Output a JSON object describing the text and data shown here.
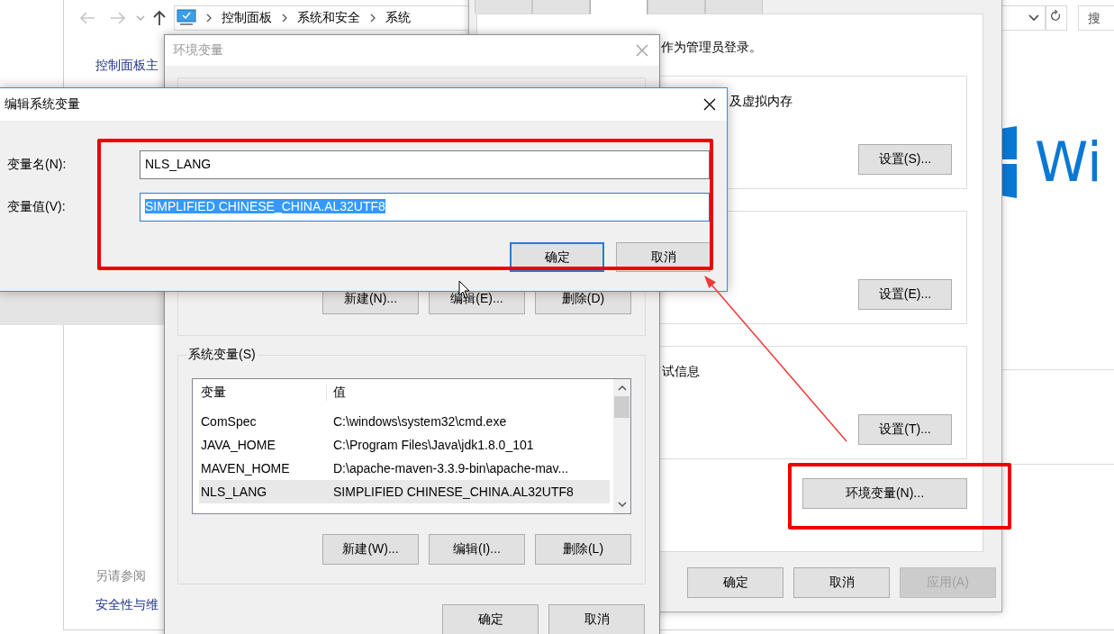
{
  "explorer": {
    "back_disabled": true,
    "forward_disabled": true,
    "breadcrumb": [
      "控制面板",
      "系统和安全",
      "系统"
    ],
    "search_placeholder": "搜",
    "sidebar_title": "控制面板主",
    "see_also": "另请参阅",
    "see_also_link": "安全性与维",
    "logo_text": "Wi"
  },
  "system_properties": {
    "tabs": [
      {
        "selected": false
      },
      {
        "selected": false
      },
      {
        "selected": true
      },
      {
        "selected": false
      },
      {
        "selected": false
      }
    ],
    "admin_note": "作为管理员登录。",
    "groups": [
      {
        "note": "及虚拟内存",
        "button": "设置(S)..."
      },
      {
        "button": "设置(E)..."
      },
      {
        "note": "试信息",
        "button": "设置(T)..."
      }
    ],
    "env_button": "环境变量(N)...",
    "buttons": [
      {
        "label": "确定",
        "disabled": false
      },
      {
        "label": "取消",
        "disabled": false
      },
      {
        "label": "应用(A)",
        "disabled": true
      }
    ]
  },
  "env_window": {
    "title": "环境变量",
    "active": false,
    "user_buttons": [
      "新建(N)...",
      "编辑(E)...",
      "删除(D)"
    ],
    "system_group": "系统变量(S)",
    "columns": [
      "变量",
      "值"
    ],
    "rows": [
      {
        "name": "ComSpec",
        "value": "C:\\windows\\system32\\cmd.exe",
        "selected": false
      },
      {
        "name": "JAVA_HOME",
        "value": "C:\\Program Files\\Java\\jdk1.8.0_101",
        "selected": false
      },
      {
        "name": "MAVEN_HOME",
        "value": "D:\\apache-maven-3.3.9-bin\\apache-mav...",
        "selected": false
      },
      {
        "name": "NLS_LANG",
        "value": "SIMPLIFIED CHINESE_CHINA.AL32UTF8",
        "selected": true
      }
    ],
    "system_buttons": [
      "新建(W)...",
      "编辑(I)...",
      "删除(L)"
    ],
    "buttons": [
      "确定",
      "取消"
    ]
  },
  "edit_dialog": {
    "title": "编辑系统变量",
    "name_label": "变量名(N):",
    "name_value": "NLS_LANG",
    "value_label": "变量值(V):",
    "value_value": "SIMPLIFIED CHINESE_CHINA.AL32UTF8",
    "value_selected": true,
    "buttons": [
      {
        "label": "确定",
        "default": true
      },
      {
        "label": "取消",
        "default": false
      }
    ]
  }
}
